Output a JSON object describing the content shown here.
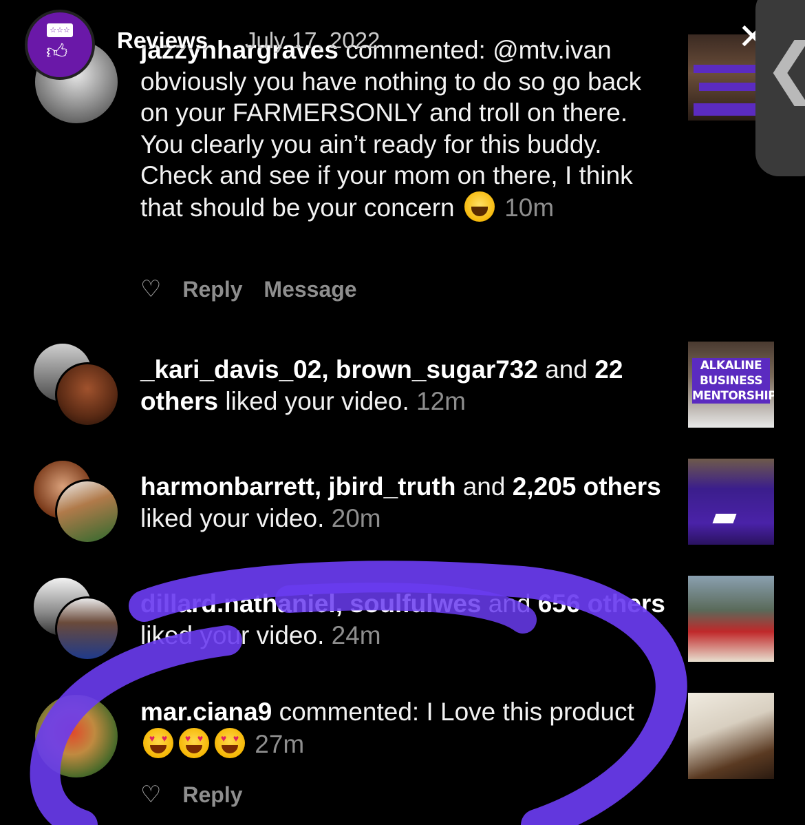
{
  "header": {
    "title": "Reviews",
    "date": "July 17, 2022",
    "close_glyph": "✕",
    "side_tab_glyph": "❮",
    "app_icon": "review-thumbs-up-icon"
  },
  "notifications": [
    {
      "type": "comment",
      "user": "jazzynhargraves",
      "verb": "commented: ",
      "text": "@mtv.ivan obviously you have nothing to do so go back on your FARMERSONLY and troll on there. You clearly you ain’t ready for this buddy. Check and see if your mom on there, I think that should be your concern",
      "emoji": "laughing-tears",
      "time": "10m",
      "actions": [
        "Reply",
        "Message"
      ],
      "thumb_lines": [
        "",
        "",
        ""
      ]
    },
    {
      "type": "like",
      "users": "_kari_davis_02, brown_sugar732",
      "and": " and ",
      "others": "22 others",
      "suffix": " liked your video.",
      "time": "12m",
      "thumb_label": "ALKALINE BUSINESS MENTORSHIP"
    },
    {
      "type": "like",
      "users": "harmonbarrett, jbird_truth",
      "and": " and ",
      "others": "2,205 others",
      "suffix": " liked your video.",
      "time": "20m"
    },
    {
      "type": "like",
      "users": "dillard.nathaniel, soulfulwes",
      "and": " and ",
      "others": "656 others",
      "suffix": " liked your video.",
      "time": "24m"
    },
    {
      "type": "comment",
      "user": "mar.ciana9",
      "verb": "commented: ",
      "text": "I Love this product",
      "emoji": "heart-eyes x3",
      "time": "27m",
      "actions": [
        "Reply"
      ]
    }
  ],
  "colors": {
    "background": "#000000",
    "secondary_text": "#8e8e8e",
    "scribble": "#6a3cf0",
    "brand_purple": "#6a18a8"
  }
}
